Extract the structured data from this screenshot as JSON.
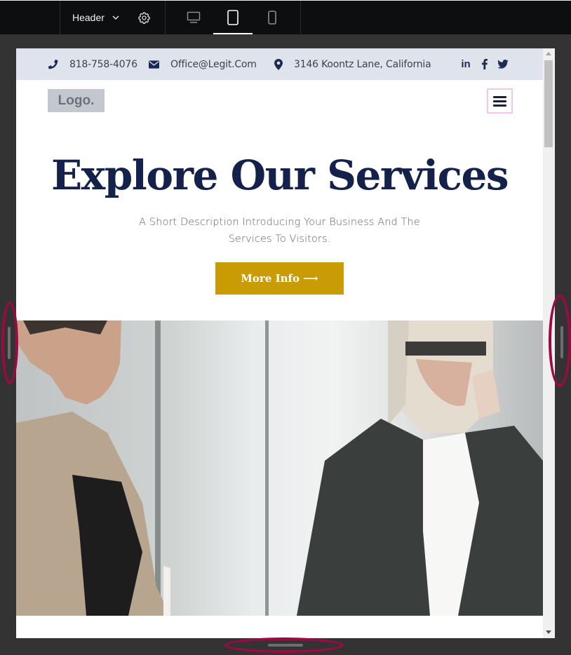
{
  "toolbar": {
    "template_selector": "Header",
    "devices": [
      {
        "name": "desktop",
        "active": false
      },
      {
        "name": "tablet",
        "active": true
      },
      {
        "name": "mobile",
        "active": false
      }
    ]
  },
  "preview": {
    "infobar": {
      "phone": "818-758-4076",
      "email": "Office@Legit.Com",
      "address": "3146 Koontz Lane, California",
      "social": [
        "linkedin",
        "facebook",
        "twitter"
      ]
    },
    "header": {
      "logo": "Logo.",
      "menu_icon": "hamburger-icon"
    },
    "hero": {
      "title": "Explore Our Services",
      "description": "A Short Description Introducing Your Business And The Services To Visitors.",
      "cta_label": "More Info ⟶",
      "cta_color": "#c99b05",
      "title_color": "#14214a"
    },
    "image": {
      "alt": "Two businesswomen in an office, one writing notes and one on the phone"
    }
  },
  "colors": {
    "toolbar_bg": "#0d0e10",
    "canvas_bg": "#333333",
    "infobar_bg": "#dfe3eb",
    "annotation_ring": "#9b0a44"
  }
}
